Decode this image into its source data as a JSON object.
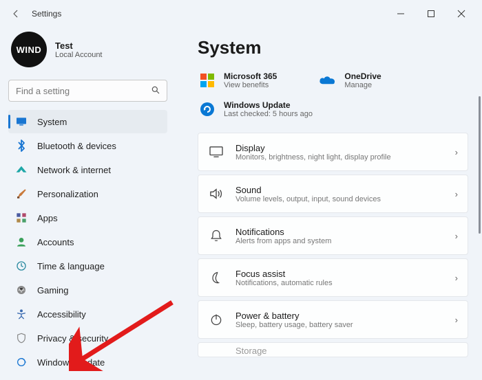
{
  "app": {
    "title": "Settings"
  },
  "profile": {
    "avatar_text": "WIND",
    "name": "Test",
    "account": "Local Account"
  },
  "search": {
    "placeholder": "Find a setting"
  },
  "nav": [
    {
      "key": "system",
      "label": "System",
      "selected": true
    },
    {
      "key": "bluetooth",
      "label": "Bluetooth & devices",
      "selected": false
    },
    {
      "key": "network",
      "label": "Network & internet",
      "selected": false
    },
    {
      "key": "personalization",
      "label": "Personalization",
      "selected": false
    },
    {
      "key": "apps",
      "label": "Apps",
      "selected": false
    },
    {
      "key": "accounts",
      "label": "Accounts",
      "selected": false
    },
    {
      "key": "time",
      "label": "Time & language",
      "selected": false
    },
    {
      "key": "gaming",
      "label": "Gaming",
      "selected": false
    },
    {
      "key": "accessibility",
      "label": "Accessibility",
      "selected": false
    },
    {
      "key": "privacy",
      "label": "Privacy & security",
      "selected": false
    },
    {
      "key": "windows-update",
      "label": "Windows Update",
      "selected": false
    }
  ],
  "main": {
    "title": "System",
    "cards": {
      "ms365": {
        "title": "Microsoft 365",
        "sub": "View benefits"
      },
      "onedrive": {
        "title": "OneDrive",
        "sub": "Manage"
      }
    },
    "update": {
      "title": "Windows Update",
      "sub": "Last checked: 5 hours ago"
    },
    "items": [
      {
        "key": "display",
        "title": "Display",
        "sub": "Monitors, brightness, night light, display profile"
      },
      {
        "key": "sound",
        "title": "Sound",
        "sub": "Volume levels, output, input, sound devices"
      },
      {
        "key": "notifications",
        "title": "Notifications",
        "sub": "Alerts from apps and system"
      },
      {
        "key": "focus",
        "title": "Focus assist",
        "sub": "Notifications, automatic rules"
      },
      {
        "key": "power",
        "title": "Power & battery",
        "sub": "Sleep, battery usage, battery saver"
      },
      {
        "key": "storage",
        "title": "Storage",
        "sub": ""
      }
    ]
  },
  "colors": {
    "arrow": "#e21b1b"
  }
}
